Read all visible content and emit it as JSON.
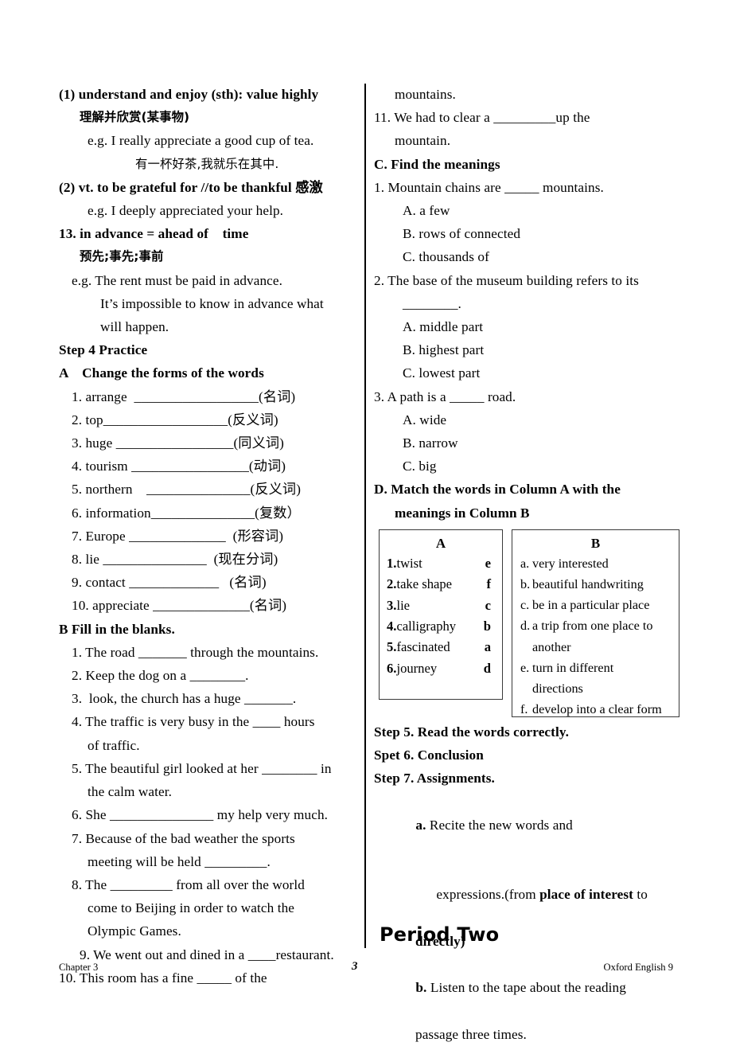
{
  "left_column": {
    "vocab_entries": [
      {
        "indent": "i0",
        "bold": true,
        "text": "(1) understand and enjoy (sth): value highly"
      },
      {
        "indent": "i2",
        "bold": true,
        "text": "理解并欣赏(某事物)",
        "cn": true
      },
      {
        "indent": "i3",
        "bold": false,
        "text": "e.g. I really appreciate a good cup of tea."
      },
      {
        "indent": "i6",
        "bold": false,
        "text": "有一杯好茶,我就乐在其中.",
        "cn": true
      },
      {
        "indent": "i0",
        "bold": true,
        "text": "(2) vt. to be grateful for //to be thankful 感激"
      },
      {
        "indent": "i3",
        "bold": false,
        "text": "e.g. I deeply appreciated your help."
      },
      {
        "indent": "i0",
        "bold": true,
        "text": "13. in advance = ahead of    time"
      },
      {
        "indent": "i2",
        "bold": true,
        "text": "预先;事先;事前",
        "cn": true
      },
      {
        "indent": "i1",
        "bold": false,
        "text": "e.g. The rent must be paid in advance."
      },
      {
        "indent": "i4",
        "bold": false,
        "text": "It’s impossible to know in advance what"
      },
      {
        "indent": "i4",
        "bold": false,
        "text": "will happen."
      }
    ],
    "step4_heading": "Step 4 Practice",
    "exercise_a_heading": "A    Change the forms of the words",
    "exercise_a_items": [
      "1. arrange  __________________(名词)",
      "2. top__________________(反义词)",
      "3. huge _________________(同义词)",
      "4. tourism _________________(动词)",
      "5. northern    _______________(反义词)",
      "6. information_______________(复数）",
      "7. Europe ______________  (形容词)",
      "8. lie _______________  (现在分词)",
      "9. contact _____________   (名词)",
      "10. appreciate ______________(名词)"
    ],
    "exercise_b_heading": "B Fill in the blanks.",
    "exercise_b_items": [
      {
        "indent": "i1",
        "lines": [
          "1. The road _______ through the mountains."
        ]
      },
      {
        "indent": "i1",
        "lines": [
          "2. Keep the dog on a ________."
        ]
      },
      {
        "indent": "i1",
        "lines": [
          "3.  look, the church has a huge _______."
        ]
      },
      {
        "indent": "i1",
        "lines": [
          "4. The traffic is very busy in the ____ hours",
          "of traffic."
        ]
      },
      {
        "indent": "i1",
        "lines": [
          "5. The beautiful girl looked at her ________ in",
          "the calm water."
        ]
      },
      {
        "indent": "i1",
        "lines": [
          "6. She _______________ my help very much."
        ]
      },
      {
        "indent": "i1",
        "lines": [
          "7. Because of the bad weather the sports",
          "meeting will be held _________."
        ]
      },
      {
        "indent": "i1",
        "lines": [
          "8. The _________ from all over the world",
          "come to Beijing in order to watch the",
          "Olympic Games."
        ]
      },
      {
        "indent": "i2",
        "lines": [
          "9. We went out and dined in a ____restaurant."
        ]
      },
      {
        "indent": "i0",
        "lines": [
          "10. This room has a fine _____ of the"
        ]
      }
    ]
  },
  "right_column": {
    "continuation": "mountains.",
    "item11": {
      "lines": [
        "11. We had to clear a _________up the",
        "mountain."
      ]
    },
    "exercise_c_heading": "C. Find the meanings",
    "exercise_c_items": [
      {
        "question": "1. Mountain chains are _____ mountains.",
        "extra": "",
        "options": [
          "A. a few",
          "B. rows of connected",
          "C. thousands of"
        ]
      },
      {
        "question": "2. The base of the museum building refers to its",
        "extra": "________.",
        "options": [
          "A. middle part",
          "B. highest part",
          "C. lowest part"
        ]
      },
      {
        "question": "3. A path is a _____ road.",
        "extra": "",
        "options": [
          "A. wide",
          "B. narrow",
          "C. big"
        ]
      }
    ],
    "exercise_d_heading_line1": "D. Match the words in Column A with the",
    "exercise_d_heading_line2": "meanings in Column B",
    "column_a": {
      "header": "A",
      "rows": [
        {
          "num": "1.",
          "word": "twist",
          "answer": "e"
        },
        {
          "num": "2.",
          "word": "take shape",
          "answer": "f"
        },
        {
          "num": "3.",
          "word": "lie",
          "answer": "c"
        },
        {
          "num": "4.",
          "word": "calligraphy",
          "answer": "b"
        },
        {
          "num": "5.",
          "word": "fascinated",
          "answer": "a"
        },
        {
          "num": "6.",
          "word": "journey",
          "answer": "d"
        }
      ]
    },
    "column_b": {
      "header": "B",
      "rows": [
        {
          "label": "a.",
          "text": "very interested",
          "cont": ""
        },
        {
          "label": "b.",
          "text": "beautiful handwriting",
          "cont": ""
        },
        {
          "label": "c.",
          "text": "be in a particular place",
          "cont": ""
        },
        {
          "label": "d.",
          "text": "a trip from one place to",
          "cont": "another"
        },
        {
          "label": "e.",
          "text": "turn in different",
          "cont": "directions"
        },
        {
          "label": "f.",
          "text": "develop into a clear form",
          "cont": ""
        }
      ]
    },
    "step5": "Step 5. Read the words correctly.",
    "step6": "Spet 6. Conclusion",
    "step7": "Step 7. Assignments.",
    "assignment_a": {
      "line1_label": "a.",
      "line1_text": " Recite the new words and",
      "line2_pre": "expressions.(from ",
      "line2_bold": "place of interest",
      "line2_post": " to",
      "line3_bold": "directly)"
    },
    "assignment_b": {
      "line1_label": "b.",
      "line1_text": " Listen to the tape about the reading",
      "line2": "passage three times."
    }
  },
  "period_heading": "Period Two",
  "footer": {
    "left": "Chapter 3",
    "page_number": "3",
    "right": "Oxford English 9"
  }
}
